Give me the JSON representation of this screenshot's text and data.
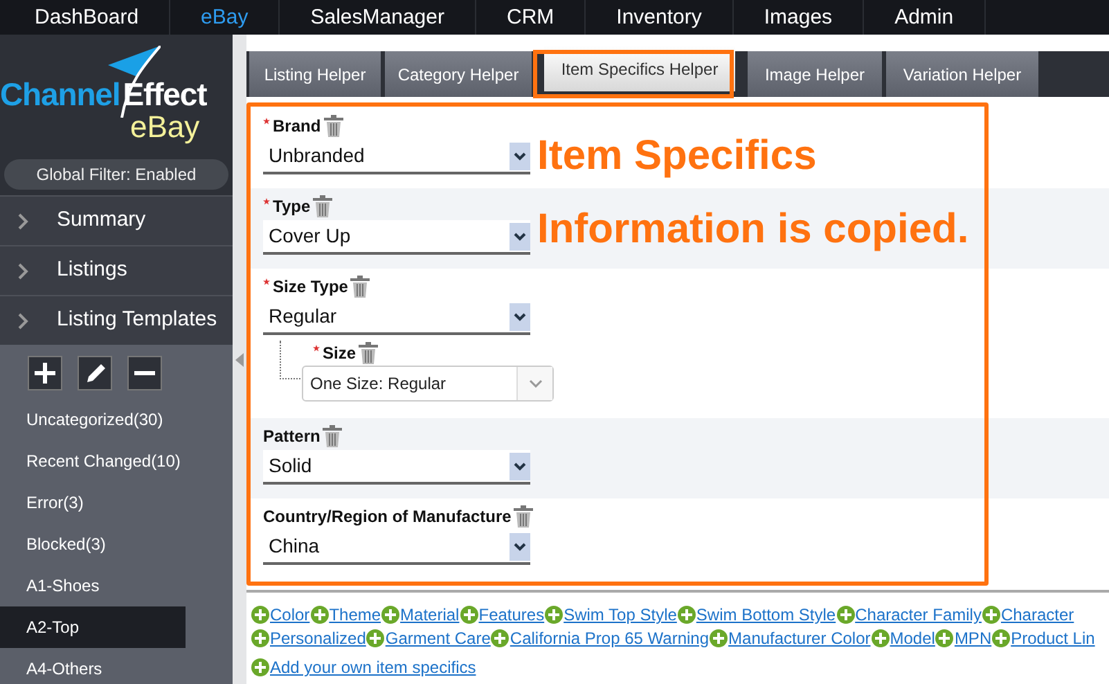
{
  "top_nav": [
    {
      "label": "DashBoard",
      "selected": false
    },
    {
      "label": "eBay",
      "selected": true
    },
    {
      "label": "SalesManager",
      "selected": false
    },
    {
      "label": "CRM",
      "selected": false
    },
    {
      "label": "Inventory",
      "selected": false
    },
    {
      "label": "Images",
      "selected": false
    },
    {
      "label": "Admin",
      "selected": false
    }
  ],
  "sidebar": {
    "logo": {
      "word_1": "Channel",
      "word_2": "Effect",
      "word_3": "eBay"
    },
    "global_filter": "Global Filter: Enabled",
    "menu": [
      "Summary",
      "Listings",
      "Listing Templates"
    ],
    "categories": [
      {
        "label": "Uncategorized(30)",
        "selected": false
      },
      {
        "label": "Recent Changed(10)",
        "selected": false
      },
      {
        "label": "Error(3)",
        "selected": false
      },
      {
        "label": "Blocked(3)",
        "selected": false
      },
      {
        "label": "A1-Shoes",
        "selected": false
      },
      {
        "label": "A2-Top",
        "selected": true
      },
      {
        "label": "A4-Others",
        "selected": false
      }
    ]
  },
  "tabs": [
    {
      "label": "Listing Helper",
      "selected": false
    },
    {
      "label": "Category Helper",
      "selected": false
    },
    {
      "label": "Item Specifics Helper",
      "selected": true
    },
    {
      "label": "Image Helper",
      "selected": false
    },
    {
      "label": "Variation Helper",
      "selected": false
    }
  ],
  "fields": [
    {
      "label": "Brand",
      "required": true,
      "value": "Unbranded"
    },
    {
      "label": "Type",
      "required": true,
      "value": "Cover Up"
    },
    {
      "label": "Size Type",
      "required": true,
      "value": "Regular",
      "children": [
        {
          "label": "Size",
          "required": true,
          "value": "One Size: Regular"
        }
      ]
    },
    {
      "label": "Pattern",
      "required": false,
      "value": "Solid"
    },
    {
      "label": "Country/Region of Manufacture",
      "required": false,
      "value": "China"
    }
  ],
  "add_links": [
    [
      "Color",
      "Theme",
      "Material",
      "Features",
      "Swim Top Style",
      "Swim Bottom Style",
      "Character Family",
      "Character"
    ],
    [
      "Personalized",
      "Garment Care",
      "California Prop 65 Warning",
      "Manufacturer Color",
      "Model",
      "MPN",
      "Product Lin"
    ],
    [
      "Add your own item specifics"
    ]
  ],
  "annotation": [
    "Item Specifics",
    "Information is copied."
  ]
}
